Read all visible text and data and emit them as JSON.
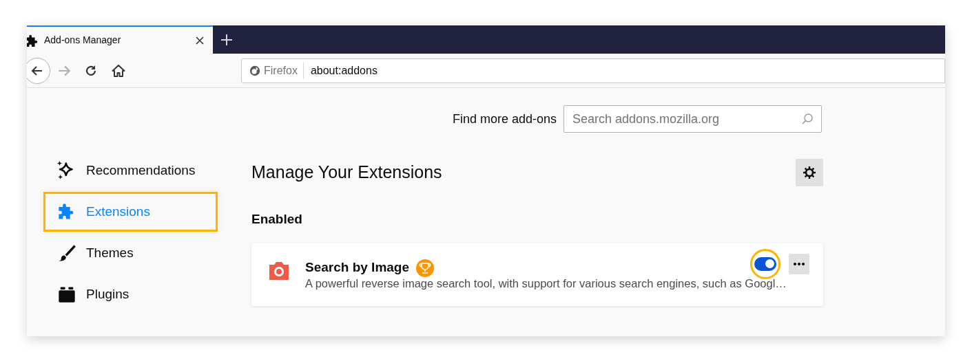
{
  "tabs": [
    {
      "title": "Add-ons Manager",
      "selected": true
    }
  ],
  "toolbar": {
    "identity": "Firefox",
    "url": "about:addons",
    "forward_disabled": true
  },
  "find_more": {
    "label": "Find more add-ons",
    "placeholder": "Search addons.mozilla.org"
  },
  "sidebar": {
    "items": [
      {
        "label": "Recommendations",
        "kind": "sparkle",
        "selected": false
      },
      {
        "label": "Extensions",
        "kind": "puzzle",
        "selected": true
      },
      {
        "label": "Themes",
        "kind": "brush",
        "selected": false
      },
      {
        "label": "Plugins",
        "kind": "block",
        "selected": false
      }
    ]
  },
  "main": {
    "title": "Manage Your Extensions",
    "section": "Enabled",
    "extensions": [
      {
        "name": "Search by Image",
        "description": "A powerful reverse image search tool, with support for various search engines, such as Googl…",
        "recommended": true,
        "on": true
      }
    ]
  }
}
